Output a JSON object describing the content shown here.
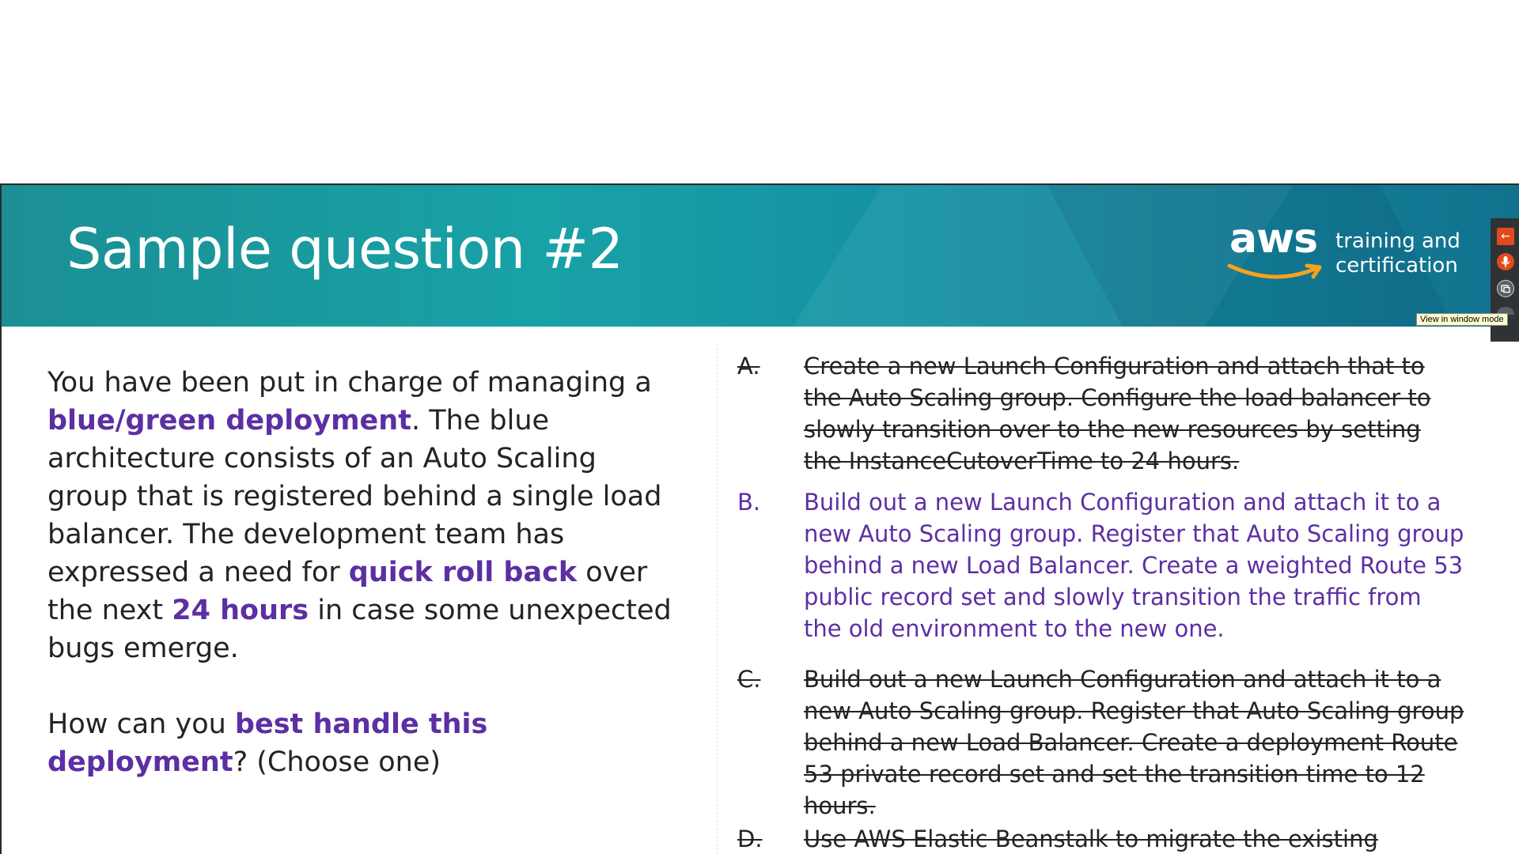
{
  "slide": {
    "title": "Sample question #2",
    "logo": {
      "brand": "aws",
      "line1": "training and",
      "line2": "certification"
    }
  },
  "toolbar": {
    "tooltip": "View in window mode"
  },
  "question": {
    "p1_a": "You have been put in charge of managing a ",
    "p1_hl1": "blue/green deployment",
    "p1_b": ". The blue architecture consists of an Auto Scaling group that is registered behind a single load balancer. The development team has expressed a need for ",
    "p1_hl2": "quick roll back",
    "p1_c": " over the next ",
    "p1_hl3": "24 hours",
    "p1_d": " in case some unexpected bugs emerge.",
    "p2_a": "How can you ",
    "p2_hl": "best handle this deployment",
    "p2_b": "? (Choose one)"
  },
  "options": [
    {
      "letter": "A.",
      "text": "Create a new Launch Configuration and attach that to the Auto Scaling group. Configure the load balancer to slowly transition over to the new resources by setting the InstanceCutoverTime to 24 hours."
    },
    {
      "letter": "B.",
      "text": "Build out a new Launch Configuration and attach it to a new Auto Scaling group. Register that Auto Scaling group behind a new Load Balancer. Create a weighted Route 53 public record set and slowly transition the traffic from the old environment to the new one."
    },
    {
      "letter": "C.",
      "text": "Build out a new Launch Configuration and attach it to a new Auto Scaling group. Register that Auto Scaling group behind a new Load Balancer. Create a deployment Route 53 private record set and set the transition time to 12 hours."
    },
    {
      "letter": "D.",
      "text": "Use AWS Elastic Beanstalk to migrate the existing"
    }
  ],
  "colors": {
    "highlight": "#5c2fa3",
    "banner_start": "#1b8f94",
    "banner_end": "#12728e",
    "toolbar_accent": "#e24a1c"
  },
  "icons": {
    "back": "arrow-left-icon",
    "mic": "microphone-icon",
    "window": "window-mode-icon"
  }
}
